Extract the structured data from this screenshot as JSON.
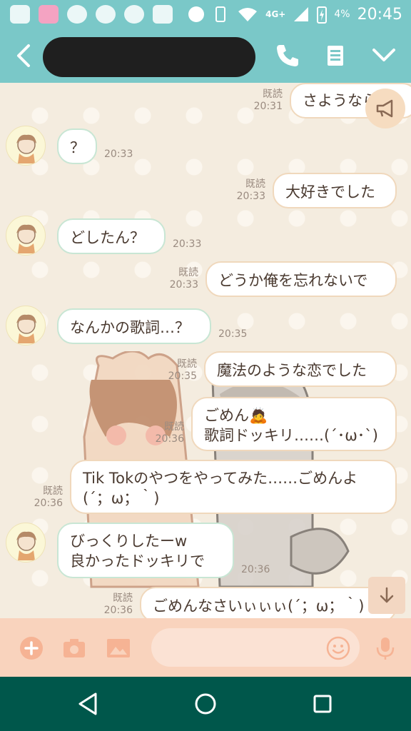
{
  "status_bar": {
    "network": "4G+",
    "battery": "4%",
    "time": "20:45"
  },
  "header": {
    "contact_name": ""
  },
  "messages": [
    {
      "dir": "out",
      "text": "さようなら",
      "read": "既読",
      "time": "20:31"
    },
    {
      "dir": "in",
      "text": "？",
      "time": "20:33"
    },
    {
      "dir": "out",
      "text": "大好きでした",
      "read": "既読",
      "time": "20:33"
    },
    {
      "dir": "in",
      "text": "どしたん？",
      "time": "20:33"
    },
    {
      "dir": "out",
      "text": "どうか俺を忘れないで",
      "read": "既読",
      "time": "20:33"
    },
    {
      "dir": "in",
      "text": "なんかの歌詞…？",
      "time": "20:35"
    },
    {
      "dir": "out",
      "text": "魔法のような恋でした",
      "read": "既読",
      "time": "20:35"
    },
    {
      "dir": "out",
      "line1": "ごめん🙇",
      "line2": "歌詞ドッキリ……(´･ω･`)",
      "read": "既読",
      "time": "20:36"
    },
    {
      "dir": "out",
      "line1": "Tik Tokのやつをやってみた……ごめんよ",
      "line2": "(´；ω；｀)",
      "read": "既読",
      "time": "20:36"
    },
    {
      "dir": "in",
      "line1": "びっくりしたーw",
      "line2": "良かったドッキリで",
      "time": "20:36"
    },
    {
      "dir": "out",
      "text": "ごめんなさいぃぃぃ(´；ω；｀)",
      "read": "既読",
      "time": "20:36"
    }
  ],
  "colors": {
    "header": "#7ac8c8",
    "chat_bg": "#f4ecdf",
    "input_bar": "#f9d3bd",
    "nav_bar": "#00574b"
  }
}
